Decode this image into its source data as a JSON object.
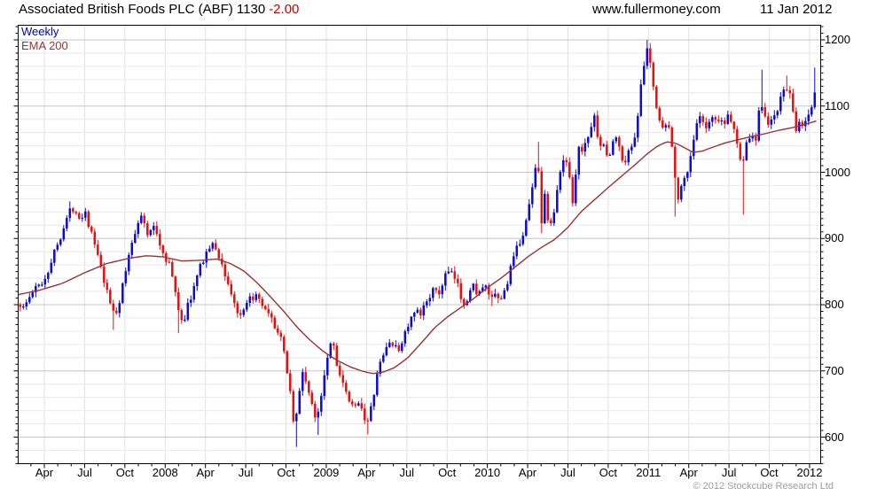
{
  "header": {
    "title": "Associated British Foods PLC (ABF) 1130",
    "change": "-2.00",
    "website": "www.fullermoney.com",
    "date": "11 Jan 2012"
  },
  "legend": {
    "series": "Weekly",
    "ema": "EMA 200"
  },
  "footer": {
    "copyright": "© 2012 Stockcube Research Ltd"
  },
  "colors": {
    "up": "#0b0bd6",
    "down": "#ea0f0f",
    "ema": "#993333",
    "grid_minor": "#eaeaea",
    "grid_major": "#c5c5c5",
    "grid_vertical": "#e2e2e2",
    "axis": "#000000",
    "change_text": "#cc0000",
    "legend_series_text": "#0000bf",
    "copyright_text": "#9c9c9c"
  },
  "chart_data": {
    "type": "candlestick",
    "timeframe": "weekly",
    "instrument": "Associated British Foods PLC",
    "ticker": "ABF",
    "last_price": 1130,
    "change": -2.0,
    "y_axis": {
      "tick_labels": [
        1200,
        1100,
        1000,
        900,
        800,
        700,
        600
      ],
      "label_step": 100,
      "gridline_step": 20,
      "minor_tick_step": 10,
      "visible_range": [
        558,
        1223
      ]
    },
    "x_axis": {
      "tick_labels": [
        "Apr",
        "Jul",
        "Oct",
        "2008",
        "Apr",
        "Jul",
        "Oct",
        "2009",
        "Apr",
        "Jul",
        "Oct",
        "2010",
        "Apr",
        "Jul",
        "Oct",
        "2011",
        "Apr",
        "Jul",
        "Oct",
        "2012"
      ],
      "start": "Feb 2007",
      "end": "Jan 2012",
      "minor_ticks": "monthly"
    },
    "close_path": [
      [
        20,
        805
      ],
      [
        26,
        795
      ],
      [
        32,
        808
      ],
      [
        38,
        822
      ],
      [
        45,
        830
      ],
      [
        52,
        842
      ],
      [
        58,
        868
      ],
      [
        65,
        892
      ],
      [
        72,
        918
      ],
      [
        78,
        940
      ],
      [
        84,
        948
      ],
      [
        90,
        930
      ],
      [
        96,
        942
      ],
      [
        102,
        912
      ],
      [
        108,
        885
      ],
      [
        114,
        852
      ],
      [
        120,
        820
      ],
      [
        126,
        795
      ],
      [
        131,
        788
      ],
      [
        136,
        812
      ],
      [
        142,
        852
      ],
      [
        148,
        890
      ],
      [
        153,
        915
      ],
      [
        158,
        938
      ],
      [
        163,
        920
      ],
      [
        168,
        902
      ],
      [
        174,
        922
      ],
      [
        180,
        892
      ],
      [
        186,
        872
      ],
      [
        192,
        860
      ],
      [
        197,
        820
      ],
      [
        202,
        790
      ],
      [
        207,
        772
      ],
      [
        212,
        800
      ],
      [
        218,
        822
      ],
      [
        224,
        850
      ],
      [
        230,
        872
      ],
      [
        236,
        886
      ],
      [
        242,
        890
      ],
      [
        248,
        868
      ],
      [
        254,
        845
      ],
      [
        260,
        820
      ],
      [
        266,
        795
      ],
      [
        271,
        778
      ],
      [
        276,
        792
      ],
      [
        281,
        806
      ],
      [
        287,
        815
      ],
      [
        293,
        802
      ],
      [
        299,
        790
      ],
      [
        305,
        778
      ],
      [
        311,
        766
      ],
      [
        317,
        745
      ],
      [
        322,
        718
      ],
      [
        327,
        672
      ],
      [
        332,
        612
      ],
      [
        336,
        650
      ],
      [
        341,
        700
      ],
      [
        346,
        682
      ],
      [
        351,
        650
      ],
      [
        356,
        625
      ],
      [
        361,
        655
      ],
      [
        366,
        698
      ],
      [
        371,
        738
      ],
      [
        375,
        748
      ],
      [
        380,
        712
      ],
      [
        385,
        685
      ],
      [
        390,
        665
      ],
      [
        395,
        650
      ],
      [
        400,
        640
      ],
      [
        404,
        658
      ],
      [
        409,
        640
      ],
      [
        414,
        618
      ],
      [
        419,
        645
      ],
      [
        424,
        685
      ],
      [
        429,
        712
      ],
      [
        434,
        730
      ],
      [
        439,
        745
      ],
      [
        444,
        738
      ],
      [
        449,
        728
      ],
      [
        454,
        748
      ],
      [
        459,
        765
      ],
      [
        464,
        778
      ],
      [
        469,
        790
      ],
      [
        474,
        782
      ],
      [
        479,
        800
      ],
      [
        484,
        815
      ],
      [
        489,
        822
      ],
      [
        494,
        812
      ],
      [
        499,
        832
      ],
      [
        504,
        850
      ],
      [
        509,
        845
      ],
      [
        514,
        838
      ],
      [
        519,
        815
      ],
      [
        524,
        802
      ],
      [
        529,
        818
      ],
      [
        534,
        828
      ],
      [
        539,
        818
      ],
      [
        544,
        822
      ],
      [
        549,
        826
      ],
      [
        554,
        806
      ],
      [
        559,
        812
      ],
      [
        564,
        806
      ],
      [
        569,
        820
      ],
      [
        574,
        845
      ],
      [
        579,
        868
      ],
      [
        584,
        888
      ],
      [
        589,
        905
      ],
      [
        594,
        930
      ],
      [
        599,
        965
      ],
      [
        603,
        1000
      ],
      [
        606,
        1043
      ],
      [
        610,
        918
      ],
      [
        614,
        965
      ],
      [
        618,
        930
      ],
      [
        622,
        918
      ],
      [
        626,
        950
      ],
      [
        630,
        985
      ],
      [
        634,
        1015
      ],
      [
        638,
        1020
      ],
      [
        642,
        1000
      ],
      [
        646,
        955
      ],
      [
        650,
        1010
      ],
      [
        654,
        1045
      ],
      [
        658,
        1030
      ],
      [
        662,
        1050
      ],
      [
        666,
        1068
      ],
      [
        670,
        1082
      ],
      [
        674,
        1058
      ],
      [
        678,
        1040
      ],
      [
        682,
        1035
      ],
      [
        686,
        1020
      ],
      [
        690,
        1040
      ],
      [
        694,
        1055
      ],
      [
        698,
        1042
      ],
      [
        702,
        1012
      ],
      [
        706,
        1022
      ],
      [
        710,
        1032
      ],
      [
        714,
        1045
      ],
      [
        718,
        1072
      ],
      [
        722,
        1120
      ],
      [
        726,
        1158
      ],
      [
        729,
        1185
      ],
      [
        733,
        1168
      ],
      [
        737,
        1125
      ],
      [
        741,
        1098
      ],
      [
        745,
        1075
      ],
      [
        749,
        1062
      ],
      [
        753,
        1078
      ],
      [
        757,
        1045
      ],
      [
        761,
        1000
      ],
      [
        765,
        962
      ],
      [
        769,
        978
      ],
      [
        773,
        995
      ],
      [
        777,
        1012
      ],
      [
        781,
        1042
      ],
      [
        785,
        1068
      ],
      [
        789,
        1082
      ],
      [
        793,
        1072
      ],
      [
        797,
        1062
      ],
      [
        801,
        1075
      ],
      [
        805,
        1085
      ],
      [
        809,
        1068
      ],
      [
        813,
        1080
      ],
      [
        817,
        1072
      ],
      [
        821,
        1088
      ],
      [
        825,
        1078
      ],
      [
        829,
        1060
      ],
      [
        833,
        1025
      ],
      [
        838,
        1020
      ],
      [
        842,
        1042
      ],
      [
        847,
        1058
      ],
      [
        852,
        1048
      ],
      [
        857,
        1112
      ],
      [
        862,
        1092
      ],
      [
        866,
        1068
      ],
      [
        870,
        1078
      ],
      [
        874,
        1088
      ],
      [
        878,
        1098
      ],
      [
        882,
        1118
      ],
      [
        886,
        1132
      ],
      [
        890,
        1120
      ],
      [
        894,
        1088
      ],
      [
        898,
        1062
      ],
      [
        902,
        1075
      ],
      [
        906,
        1070
      ],
      [
        910,
        1082
      ],
      [
        914,
        1090
      ],
      [
        918,
        1118
      ],
      [
        921,
        1130
      ]
    ],
    "ema_path": [
      [
        20,
        815
      ],
      [
        45,
        822
      ],
      [
        70,
        832
      ],
      [
        95,
        848
      ],
      [
        120,
        862
      ],
      [
        145,
        870
      ],
      [
        165,
        874
      ],
      [
        185,
        872
      ],
      [
        205,
        866
      ],
      [
        225,
        867
      ],
      [
        245,
        869
      ],
      [
        260,
        862
      ],
      [
        275,
        851
      ],
      [
        290,
        833
      ],
      [
        305,
        812
      ],
      [
        320,
        790
      ],
      [
        335,
        766
      ],
      [
        350,
        746
      ],
      [
        365,
        729
      ],
      [
        380,
        716
      ],
      [
        395,
        706
      ],
      [
        410,
        699
      ],
      [
        420,
        696
      ],
      [
        432,
        698
      ],
      [
        445,
        705
      ],
      [
        460,
        720
      ],
      [
        475,
        742
      ],
      [
        490,
        765
      ],
      [
        505,
        782
      ],
      [
        520,
        796
      ],
      [
        535,
        810
      ],
      [
        550,
        826
      ],
      [
        565,
        840
      ],
      [
        580,
        856
      ],
      [
        595,
        872
      ],
      [
        610,
        886
      ],
      [
        625,
        898
      ],
      [
        640,
        916
      ],
      [
        655,
        940
      ],
      [
        670,
        958
      ],
      [
        685,
        976
      ],
      [
        700,
        993
      ],
      [
        715,
        1010
      ],
      [
        730,
        1028
      ],
      [
        742,
        1040
      ],
      [
        752,
        1046
      ],
      [
        762,
        1044
      ],
      [
        772,
        1037
      ],
      [
        782,
        1030
      ],
      [
        792,
        1032
      ],
      [
        802,
        1037
      ],
      [
        817,
        1044
      ],
      [
        832,
        1049
      ],
      [
        847,
        1054
      ],
      [
        862,
        1058
      ],
      [
        877,
        1063
      ],
      [
        892,
        1067
      ],
      [
        907,
        1072
      ],
      [
        922,
        1078
      ]
    ],
    "extreme_wicks": [
      [
        80,
        "h",
        956
      ],
      [
        128,
        "l",
        762
      ],
      [
        203,
        "l",
        757
      ],
      [
        333,
        "l",
        585
      ],
      [
        358,
        "l",
        603
      ],
      [
        414,
        "l",
        604
      ],
      [
        554,
        "l",
        798
      ],
      [
        606,
        "h",
        1046
      ],
      [
        611,
        "l",
        908
      ],
      [
        730,
        "h",
        1200
      ],
      [
        763,
        "l",
        933
      ],
      [
        839,
        "l",
        936
      ],
      [
        858,
        "h",
        1155
      ],
      [
        888,
        "h",
        1146
      ],
      [
        921,
        "h",
        1158
      ]
    ]
  }
}
